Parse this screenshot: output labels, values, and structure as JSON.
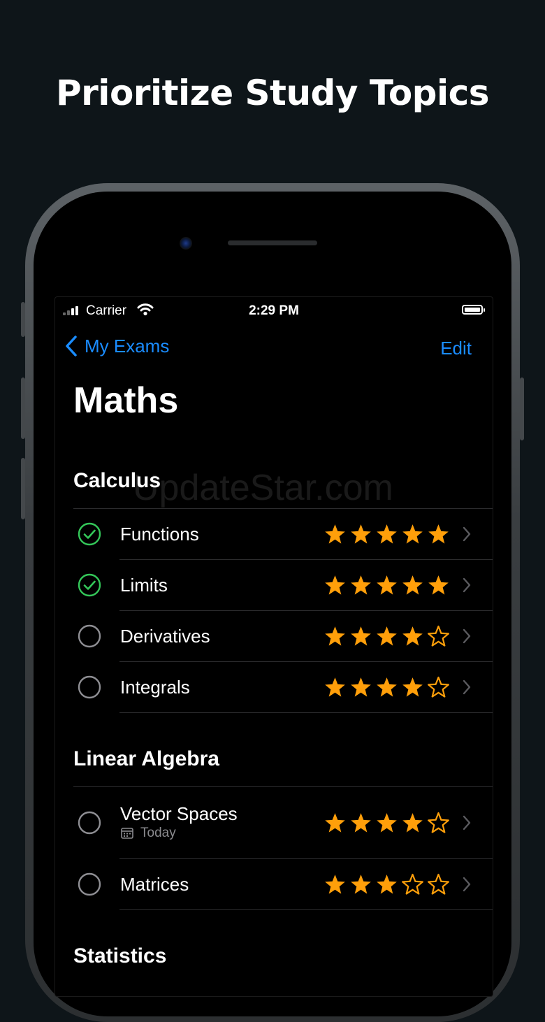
{
  "headline": "Prioritize Study Topics",
  "status_bar": {
    "carrier": "Carrier",
    "time": "2:29 PM"
  },
  "nav": {
    "back_label": "My Exams",
    "edit_label": "Edit"
  },
  "page_title": "Maths",
  "watermark": "UpdateStar.com",
  "colors": {
    "accent": "#1a8cff",
    "star": "#ff9f0a",
    "check": "#34c759",
    "background": "#000000"
  },
  "sections": [
    {
      "title": "Calculus",
      "items": [
        {
          "label": "Functions",
          "completed": true,
          "rating": 5
        },
        {
          "label": "Limits",
          "completed": true,
          "rating": 5
        },
        {
          "label": "Derivatives",
          "completed": false,
          "rating": 4
        },
        {
          "label": "Integrals",
          "completed": false,
          "rating": 4
        }
      ]
    },
    {
      "title": "Linear Algebra",
      "items": [
        {
          "label": "Vector Spaces",
          "completed": false,
          "rating": 4,
          "subtitle": "Today",
          "subtitle_icon": "calendar-icon"
        },
        {
          "label": "Matrices",
          "completed": false,
          "rating": 3
        }
      ]
    },
    {
      "title": "Statistics",
      "items": []
    }
  ]
}
